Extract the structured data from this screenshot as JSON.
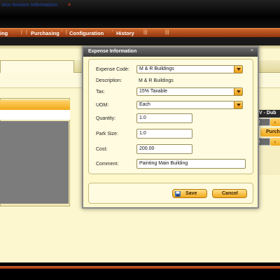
{
  "menu": {
    "items": [
      "ing",
      "Purchasing",
      "Configuration",
      "History"
    ]
  },
  "tab": {
    "label": "vice Invoice Information",
    "close": "×"
  },
  "right_panel": {
    "header": "V - Dub",
    "row1": ")",
    "purch": "Purch",
    "row2": ")"
  },
  "dialog": {
    "title": "Expense Information",
    "close": "×",
    "fields": {
      "expense_code": {
        "label": "Expense Code:",
        "value": "M & R Buildings"
      },
      "description": {
        "label": "Description:",
        "value": "M & R Buildings"
      },
      "tax": {
        "label": "Tax:",
        "value": "15% Taxable"
      },
      "uom": {
        "label": "UOM:",
        "value": "Each"
      },
      "quantity": {
        "label": "Quantity:",
        "value": "1.0"
      },
      "park_size": {
        "label": "Park Size:",
        "value": "1.0"
      },
      "cost": {
        "label": "Cost:",
        "value": "200.00"
      },
      "comment": {
        "label": "Comment:",
        "value": "Painting Main Building"
      }
    },
    "buttons": {
      "save": "Save",
      "cancel": "Cancel"
    }
  },
  "colors": {
    "accent_orange": "#d0662a",
    "button_gold": "#f2aa1c",
    "panel_cream": "#fff8cc",
    "tab_text": "#1f3c88"
  }
}
